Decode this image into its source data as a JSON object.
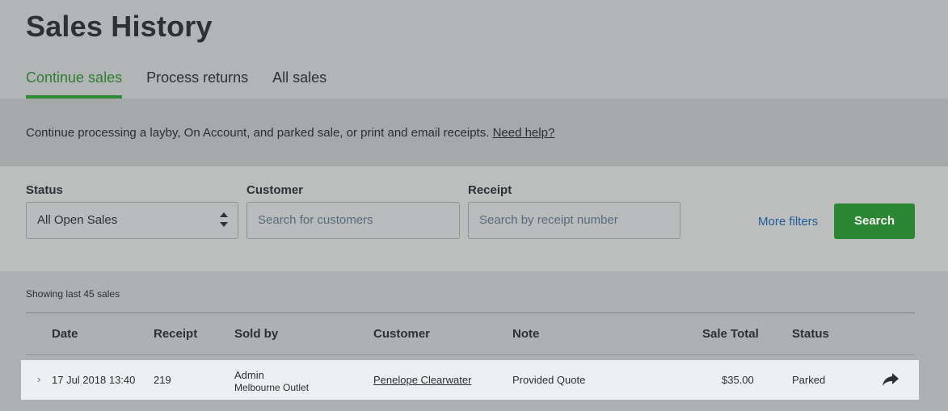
{
  "page": {
    "title": "Sales History"
  },
  "tabs": [
    {
      "label": "Continue sales",
      "active": true
    },
    {
      "label": "Process returns",
      "active": false
    },
    {
      "label": "All sales",
      "active": false
    }
  ],
  "info": {
    "text": "Continue processing a layby, On Account, and parked sale, or print and email receipts.",
    "help_link": "Need help?"
  },
  "filters": {
    "status": {
      "label": "Status",
      "value": "All Open Sales"
    },
    "customer": {
      "label": "Customer",
      "placeholder": "Search for customers"
    },
    "receipt": {
      "label": "Receipt",
      "placeholder": "Search by receipt number"
    },
    "more_filters": "More filters",
    "search_button": "Search"
  },
  "results": {
    "showing": "Showing last 45 sales",
    "columns": [
      "Date",
      "Receipt",
      "Sold by",
      "Customer",
      "Note",
      "Sale Total",
      "Status"
    ],
    "rows": [
      {
        "date": "17 Jul 2018 13:40",
        "receipt": "219",
        "sold_by": "Admin",
        "outlet": "Melbourne Outlet",
        "customer": "Penelope Clearwater",
        "note": "Provided Quote",
        "total": "$35.00",
        "status": "Parked"
      }
    ]
  },
  "colors": {
    "accent": "#2b8634",
    "link": "#1f5d9a"
  },
  "icons": {
    "expand": "chevron-right-icon",
    "action": "share-arrow-icon"
  }
}
